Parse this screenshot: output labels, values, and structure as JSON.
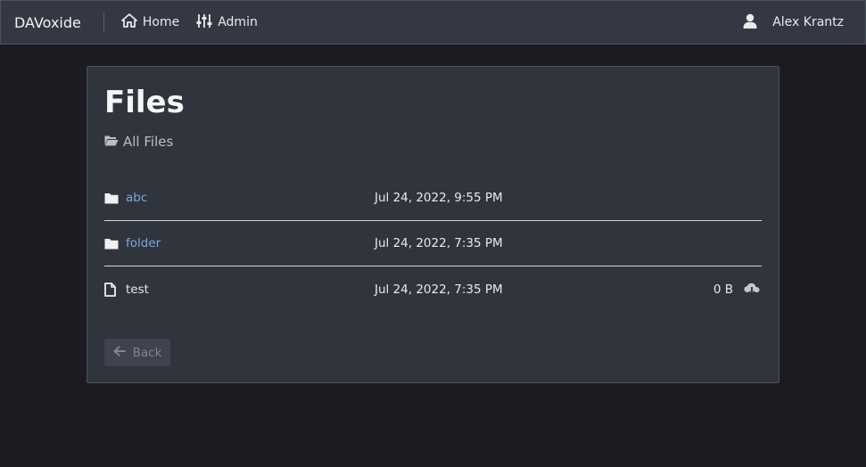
{
  "navbar": {
    "brand": "DAVoxide",
    "home_label": "Home",
    "admin_label": "Admin",
    "user_name": "Alex Krantz"
  },
  "page": {
    "title": "Files",
    "breadcrumb": "All Files"
  },
  "files": [
    {
      "name": "abc",
      "type": "folder",
      "date": "Jul 24, 2022, 9:55 PM",
      "size": ""
    },
    {
      "name": "folder",
      "type": "folder",
      "date": "Jul 24, 2022, 7:35 PM",
      "size": ""
    },
    {
      "name": "test",
      "type": "file",
      "date": "Jul 24, 2022, 7:35 PM",
      "size": "0 B"
    }
  ],
  "actions": {
    "back_label": "Back"
  },
  "icons": {
    "home": "home-icon",
    "admin": "sliders-icon",
    "user": "user-icon",
    "breadcrumb": "folder-open-icon",
    "folder": "folder-icon",
    "file": "file-icon",
    "download": "cloud-download-icon",
    "back": "arrow-left-icon"
  },
  "colors": {
    "background": "#1c1b22",
    "navbar": "#333842",
    "card": "#30343d",
    "link": "#7ea6e0"
  }
}
